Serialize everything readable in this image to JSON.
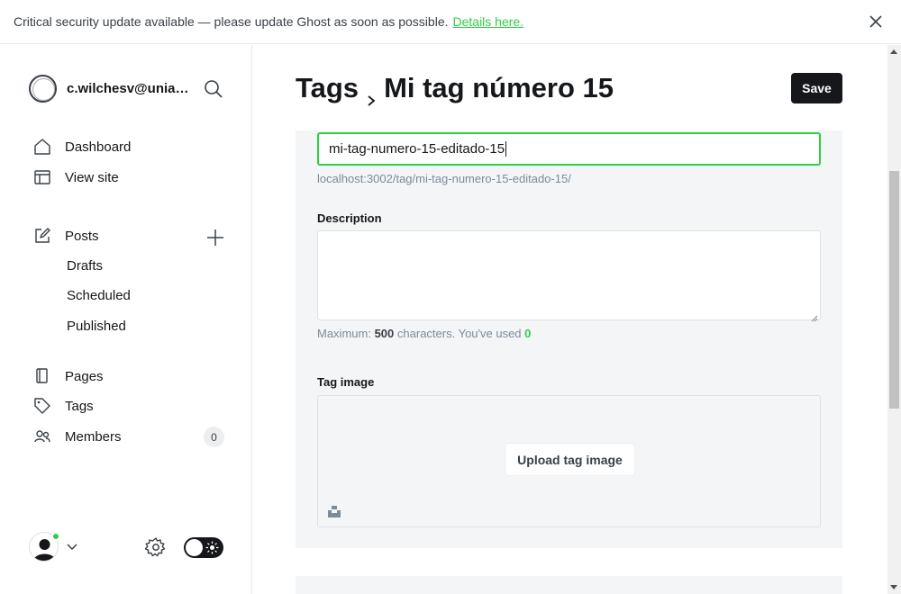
{
  "banner": {
    "message": "Critical security update available — please update Ghost as soon as possible.",
    "link_text": "Details here.",
    "close_icon": "close-icon"
  },
  "sidebar": {
    "account_name": "c.wilchesv@uniandes.edu.co",
    "nav": {
      "dashboard": "Dashboard",
      "view_site": "View site",
      "posts": "Posts",
      "drafts": "Drafts",
      "scheduled": "Scheduled",
      "published": "Published",
      "pages": "Pages",
      "tags": "Tags",
      "members": "Members",
      "members_count": "0"
    }
  },
  "header": {
    "breadcrumb_parent": "Tags",
    "title": "Mi tag número 15",
    "save_label": "Save"
  },
  "form": {
    "slug_value": "mi-tag-numero-15-editado-15",
    "slug_url": "localhost:3002/tag/mi-tag-numero-15-editado-15/",
    "description_label": "Description",
    "description_value": "",
    "char_prefix": "Maximum:",
    "char_max": "500",
    "char_mid": "characters. You've used",
    "char_used": "0",
    "tag_image_label": "Tag image",
    "upload_label": "Upload tag image"
  },
  "colors": {
    "accent_green": "#30cf43",
    "dark": "#15171a",
    "panel_bg": "#f4f5f6"
  }
}
